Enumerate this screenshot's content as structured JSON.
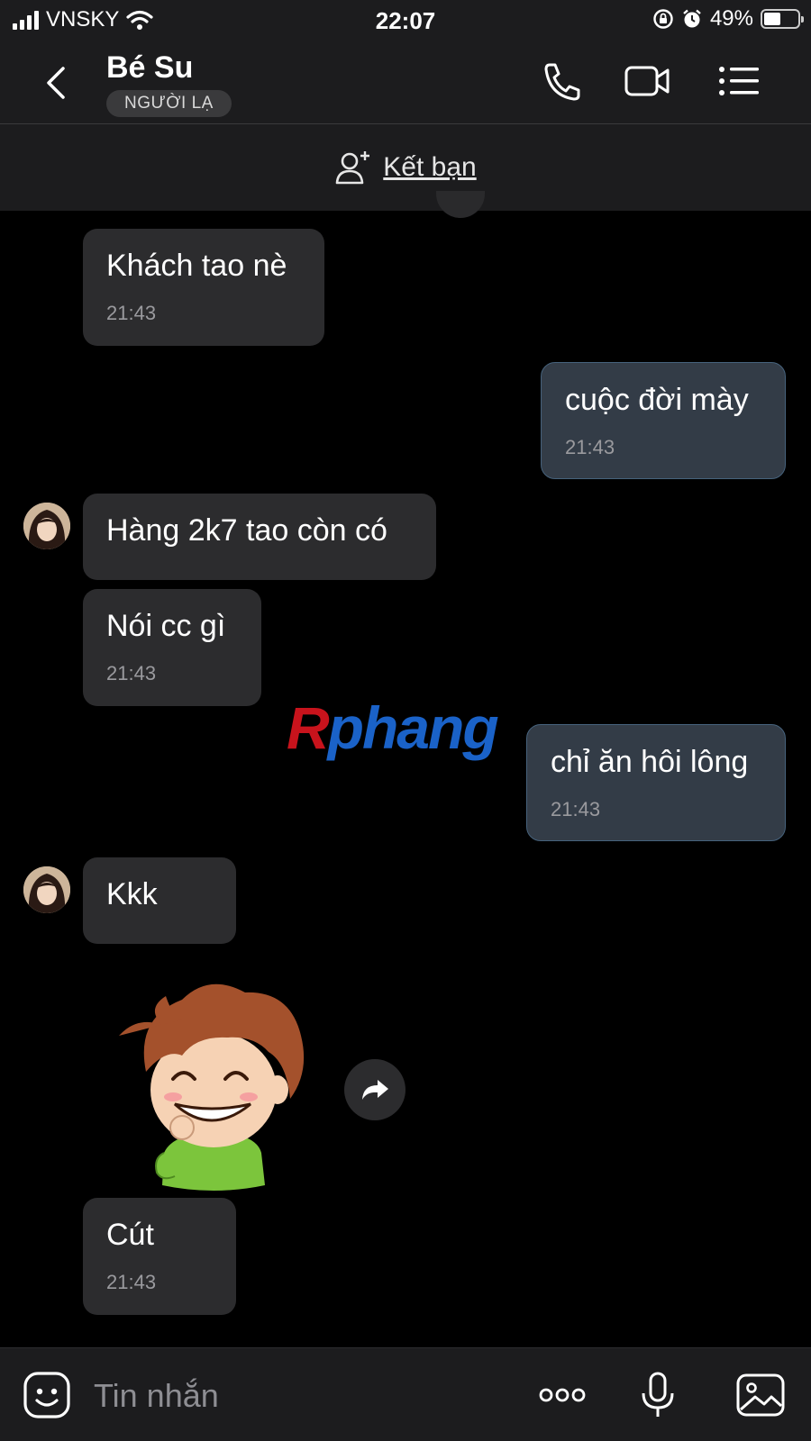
{
  "status_bar": {
    "carrier": "VNSKY",
    "time": "22:07",
    "battery": "49%",
    "battery_level": 0.49
  },
  "header": {
    "contact_name": "Bé Su",
    "contact_badge": "NGƯỜI LẠ"
  },
  "friend_bar": {
    "label": "Kết bạn"
  },
  "messages": [
    {
      "side": "in",
      "text": "Khách tao nè",
      "time": "21:43"
    },
    {
      "side": "out",
      "text": "cuộc đời mày",
      "time": "21:43"
    },
    {
      "side": "in",
      "text": "Hàng 2k7 tao còn có"
    },
    {
      "side": "in",
      "text": "Nói cc gì",
      "time": "21:43"
    },
    {
      "side": "out",
      "text": "chỉ ăn hôi lông",
      "time": "21:43"
    },
    {
      "side": "in",
      "text": "Kkk"
    },
    {
      "side": "in",
      "type": "sticker",
      "sticker": "grinning-boy-sticker"
    },
    {
      "side": "in",
      "text": "Cút",
      "time": "21:43"
    }
  ],
  "watermark": {
    "first": "R",
    "rest": "phang"
  },
  "composer": {
    "placeholder": "Tin nhắn"
  },
  "colors": {
    "background": "#000000",
    "bar": "#1c1c1e",
    "incoming_bubble": "#2c2c2e",
    "outgoing_bubble": "#333c47",
    "outgoing_border": "#46627c",
    "timestamp": "#9a9a9e"
  }
}
